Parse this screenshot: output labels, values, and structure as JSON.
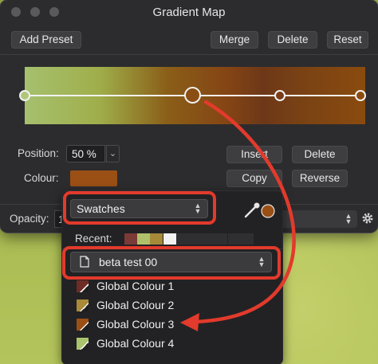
{
  "window": {
    "title": "Gradient Map",
    "toolbar": {
      "add_preset": "Add Preset",
      "merge": "Merge",
      "delete": "Delete",
      "reset": "Reset"
    }
  },
  "stop_editor": {
    "position_label": "Position:",
    "position_value": "50 %",
    "colour_label": "Colour:",
    "colour_value": "#9a4f15",
    "insert": "Insert",
    "delete": "Delete",
    "copy": "Copy",
    "reverse": "Reverse"
  },
  "footer": {
    "opacity_label": "Opacity:",
    "opacity_value_partial": "1"
  },
  "popover": {
    "category_select": "Swatches",
    "recent_label": "Recent:",
    "recent_colors": [
      "#7a3a36",
      "#b0c06a",
      "#a68a3a",
      "#f2f2f2",
      "#2f2f31",
      "#2f2f31",
      "#2f2f31",
      "#2f2f31",
      "#2f2f31",
      "#2f2f31"
    ],
    "palette_select": "beta test 00",
    "swatches": [
      {
        "name": "Global Colour 1",
        "color": "#6e2c24"
      },
      {
        "name": "Global Colour 2",
        "color": "#a88a38"
      },
      {
        "name": "Global Colour 3",
        "color": "#9a4f15"
      },
      {
        "name": "Global Colour 4",
        "color": "#a9c46c"
      }
    ]
  },
  "annotation_color": "#e23a2c",
  "accent_colors": {
    "panel_bg": "#2c2c2e",
    "button_bg": "#3e3e40"
  }
}
